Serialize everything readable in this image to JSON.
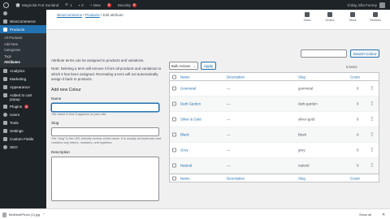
{
  "adminbar": {
    "site_name": "Magnolia Fort Sunland",
    "comments_count": "0",
    "updates_count": "1",
    "new_label": "+ New",
    "notif_count": "8",
    "security_label": "Security",
    "security_count": "8",
    "greeting": "G'day, Ella Forney"
  },
  "sidebar": {
    "items_top": [
      {
        "label": "WooCommerce"
      }
    ],
    "products_label": "Products",
    "submenu": [
      {
        "label": "All Products"
      },
      {
        "label": "Add New"
      },
      {
        "label": "Categories"
      },
      {
        "label": "Tags"
      },
      {
        "label": "Attributes"
      }
    ],
    "items_bottom": [
      {
        "label": "Analytics"
      },
      {
        "label": "Marketing"
      },
      {
        "label": "Appearance"
      },
      {
        "label": "Added to cart popup"
      },
      {
        "label": "Plugins",
        "badge": "6"
      },
      {
        "label": "Users"
      },
      {
        "label": "Tools"
      },
      {
        "label": "Settings"
      },
      {
        "label": "Custom Fields"
      },
      {
        "label": "SEO"
      }
    ]
  },
  "header": {
    "breadcrumb": [
      "WooCommerce",
      "Products",
      "Edit attribute"
    ],
    "sep": "/",
    "actions": [
      {
        "label": "Inbox",
        "icon": "inbox-icon"
      },
      {
        "label": "Orders",
        "icon": "orders-icon"
      },
      {
        "label": "Stock",
        "icon": "stock-icon"
      },
      {
        "label": "Reviews",
        "icon": "reviews-icon"
      }
    ]
  },
  "form": {
    "intro": "Attribute terms can be assigned to products and variations.",
    "note": "Note: Deleting a term will remove it from all products and variations to which it has been assigned. Recreating a term will not automatically assign it back to products.",
    "heading": "Add new Colour",
    "name_label": "Name",
    "name_help": "The name is how it appears on your site.",
    "slug_label": "Slug",
    "slug_help": "The “slug” is the URL-friendly version of the name. It is usually all lowercase and contains only letters, numbers, and hyphens.",
    "description_label": "Description"
  },
  "search": {
    "button": "Search Colour"
  },
  "bulk": {
    "select": "Bulk Actions",
    "apply": "Apply",
    "count": "6 items"
  },
  "table": {
    "columns": {
      "name": "Name",
      "description": "Description",
      "slug": "Slug",
      "count": "Count"
    },
    "rows": [
      {
        "name": "Gunmetal",
        "description": "—",
        "slug": "gunmetal",
        "count": "0"
      },
      {
        "name": "Dark Garden",
        "description": "—",
        "slug": "dark-garden",
        "count": "0"
      },
      {
        "name": "Silver & Gold",
        "description": "—",
        "slug": "silver-gold",
        "count": "0"
      },
      {
        "name": "Black",
        "description": "—",
        "slug": "black",
        "count": "0"
      },
      {
        "name": "Grey",
        "description": "—",
        "slug": "grey",
        "count": "0"
      },
      {
        "name": "Natural",
        "description": "—",
        "slug": "natural",
        "count": "0"
      }
    ]
  },
  "taskbar": {
    "download": "BirdNestPhoto (1).jpg",
    "show_all": "Show all",
    "close": "✕"
  },
  "colors": {
    "wp_dark": "#1d2327",
    "wp_blue": "#2271b1",
    "badge_red": "#d63638"
  }
}
